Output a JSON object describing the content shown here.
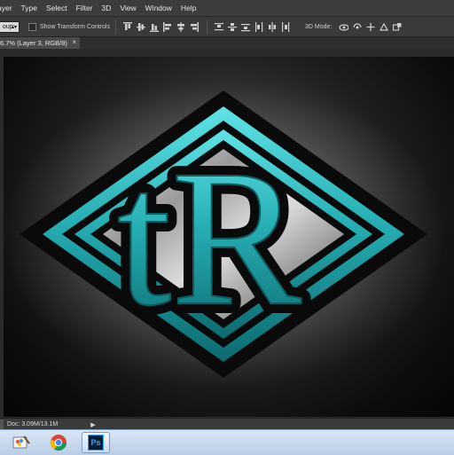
{
  "menu": [
    "ayer",
    "Type",
    "Select",
    "Filter",
    "3D",
    "View",
    "Window",
    "Help"
  ],
  "options_bar": {
    "group_select": "oup:",
    "show_transform_controls": "Show Transform Controls",
    "mode_label": "3D Mode:"
  },
  "document_tab": {
    "title": "6.7% (Layer 3, RGB/8)"
  },
  "artwork": {
    "logo_text": "tR",
    "colors": {
      "teal": "#2ab3b8",
      "teal_dark": "#0e5f64",
      "outline": "#0a0a0a",
      "silver": "#bdbdbd"
    }
  },
  "status_bar": {
    "doc_info": "Doc: 3.09M/13.1M"
  },
  "taskbar": {
    "items": [
      {
        "icon": "paint-app-icon"
      },
      {
        "icon": "chrome-icon"
      },
      {
        "icon": "photoshop-icon",
        "label": "Ps"
      }
    ]
  }
}
